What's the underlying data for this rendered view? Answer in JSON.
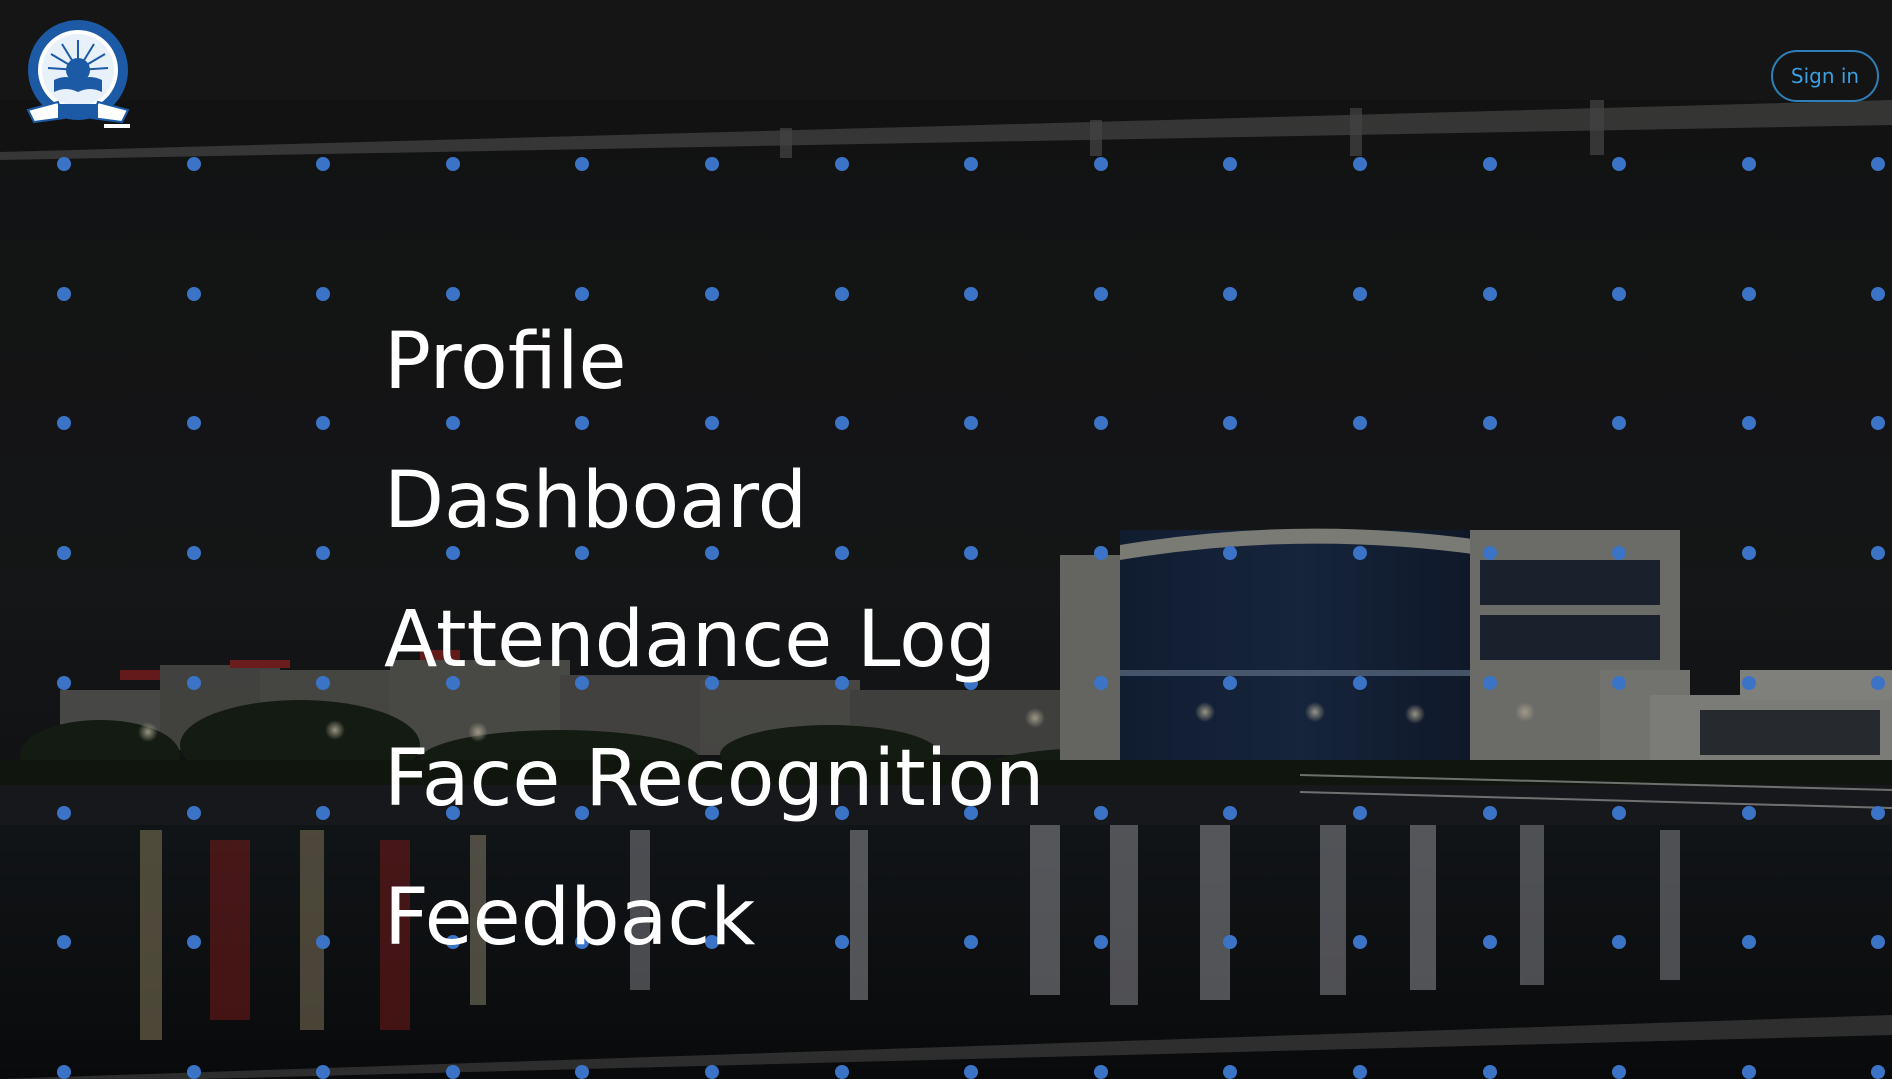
{
  "header": {
    "logo": {
      "name": "IIT Indore emblem",
      "icon": "institute-seal-icon",
      "colors": {
        "primary": "#1c5aa6",
        "ring": "#ffffff"
      }
    },
    "sign_in_label": "Sign in"
  },
  "menu": {
    "items": [
      {
        "label": "Profile"
      },
      {
        "label": "Dashboard"
      },
      {
        "label": "Attendance Log"
      },
      {
        "label": "Face Recognition"
      },
      {
        "label": "Feedback"
      }
    ]
  },
  "theme": {
    "dot_color": "#3b74c7",
    "accent": "#2e7fb8",
    "accent_text": "#3b9fe0",
    "menu_text": "#ffffff",
    "header_bg": "#151515"
  }
}
